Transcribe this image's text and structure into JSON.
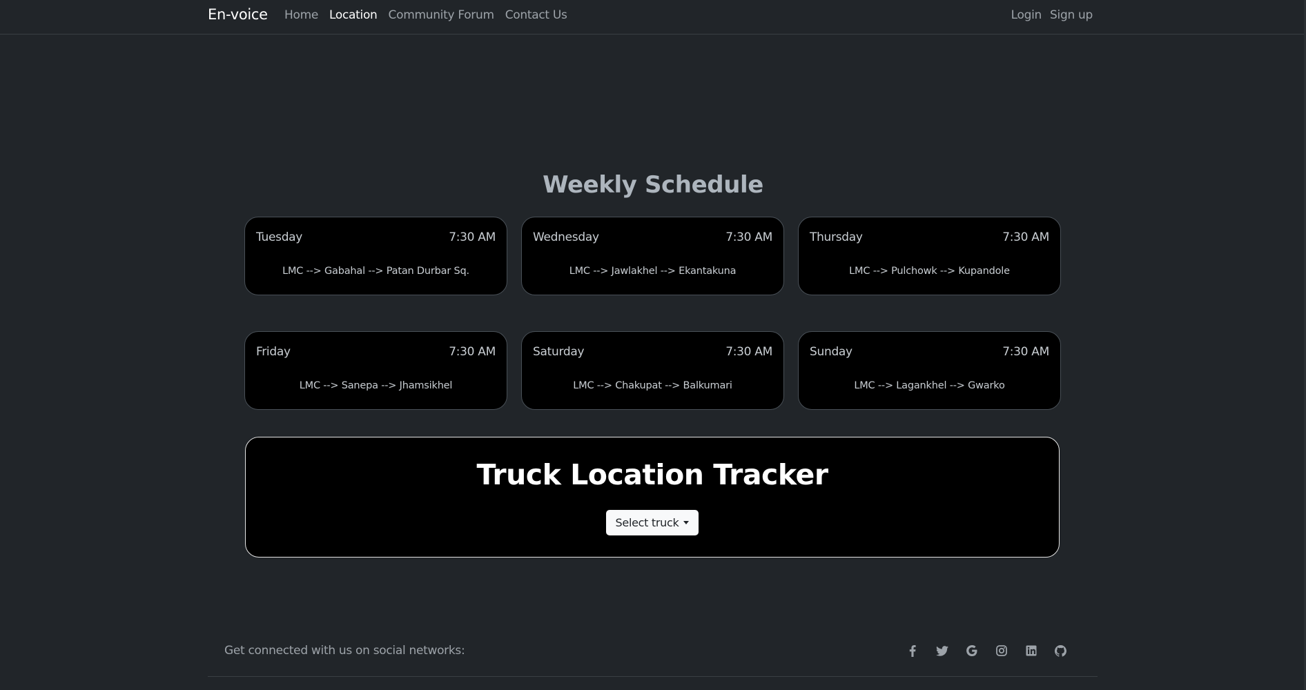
{
  "nav": {
    "brand": "En-voice",
    "links": [
      "Home",
      "Location",
      "Community Forum",
      "Contact Us"
    ],
    "active": "Location",
    "login": "Login",
    "signup": "Sign up"
  },
  "schedule": {
    "title": "Weekly Schedule",
    "cards": [
      {
        "day": "Tuesday",
        "time": "7:30 AM",
        "route": "LMC --> Gabahal --> Patan Durbar Sq."
      },
      {
        "day": "Wednesday",
        "time": "7:30 AM",
        "route": "LMC --> Jawlakhel --> Ekantakuna"
      },
      {
        "day": "Thursday",
        "time": "7:30 AM",
        "route": "LMC --> Pulchowk --> Kupandole"
      },
      {
        "day": "Friday",
        "time": "7:30 AM",
        "route": "LMC --> Sanepa --> Jhamsikhel"
      },
      {
        "day": "Saturday",
        "time": "7:30 AM",
        "route": "LMC --> Chakupat --> Balkumari"
      },
      {
        "day": "Sunday",
        "time": "7:30 AM",
        "route": "LMC --> Lagankhel --> Gwarko"
      }
    ]
  },
  "tracker": {
    "title": "Truck Location Tracker",
    "select_label": "Select truck"
  },
  "footer": {
    "text": "Get connected with us on social networks:",
    "social_icons": [
      "facebook-icon",
      "twitter-icon",
      "google-icon",
      "instagram-icon",
      "linkedin-icon",
      "github-icon"
    ]
  }
}
